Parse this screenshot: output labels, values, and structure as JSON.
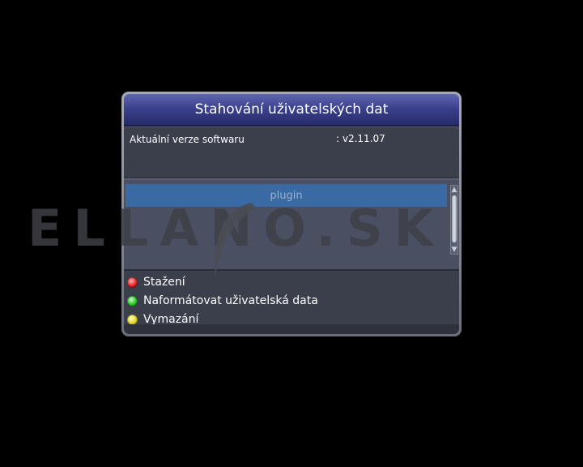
{
  "dialog": {
    "title": "Stahování uživatelských dat",
    "software_version_label": "Aktuální verze softwaru",
    "software_version_value": ": v2.11.07",
    "list_items": [
      "plugin"
    ],
    "actions": [
      {
        "label": "Stažení",
        "color": "red"
      },
      {
        "label": "Naformátovat uživatelská data",
        "color": "green"
      },
      {
        "label": "Vymazání",
        "color": "yellow"
      }
    ]
  },
  "watermark": {
    "text": "ELLANO.SK"
  },
  "colors": {
    "background": "#000000",
    "title_bar": "#3c428c",
    "selected_item": "#3a6aa3",
    "panel": "#3b3f4c"
  }
}
